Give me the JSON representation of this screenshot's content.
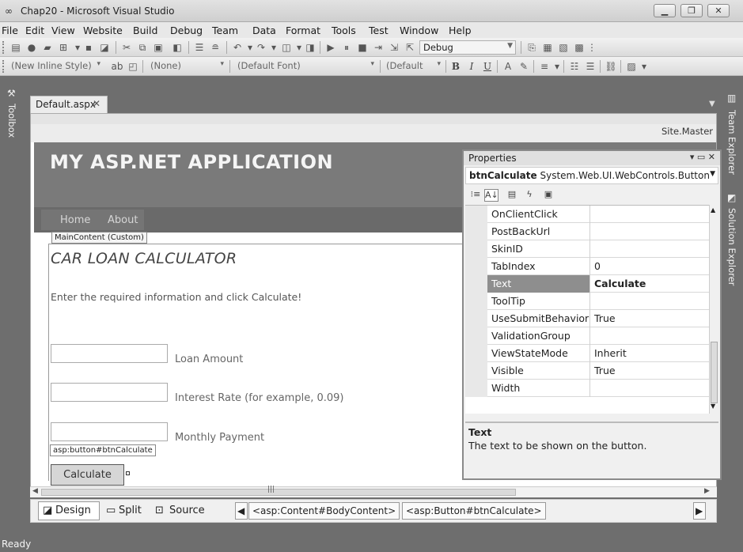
{
  "window": {
    "title": "Chap20 - Microsoft Visual Studio",
    "app_icon": "infinity-icon",
    "minimize_icon": "—",
    "restore_icon": "❐",
    "close_icon": "✕"
  },
  "menu": [
    "File",
    "Edit",
    "View",
    "Website",
    "Build",
    "Debug",
    "Team",
    "Data",
    "Format",
    "Tools",
    "Test",
    "Window",
    "Help"
  ],
  "toolbar1": {
    "config": "Debug"
  },
  "toolbar2": {
    "style_combo": "(New Inline Style)",
    "block_combo": "(None)",
    "font_combo": "(Default Font)",
    "size_combo": "(Default",
    "bold": "B",
    "italic": "I",
    "underline": "U"
  },
  "side_tabs": {
    "toolbox": "Toolbox",
    "team_explorer": "Team Explorer",
    "solution_explorer": "Solution Explorer"
  },
  "document": {
    "tab": "Default.aspx",
    "tab_close": "✕",
    "master": "Site.Master"
  },
  "page": {
    "app_title": "MY ASP.NET APPLICATION",
    "nav": [
      "Home",
      "About"
    ],
    "content_label": "MainContent (Custom)",
    "heading": "CAR LOAN CALCULATOR",
    "instructions": "Enter the required information and click Calculate!",
    "fields": [
      {
        "label": "Loan Amount",
        "value": ""
      },
      {
        "label": "Interest Rate (for example, 0.09)",
        "value": ""
      },
      {
        "label": "Monthly Payment",
        "value": ""
      }
    ],
    "button_tag": "asp:button#btnCalculate",
    "button_text": "Calculate"
  },
  "viewbar": {
    "design": "Design",
    "split": "Split",
    "source": "Source",
    "crumbs": [
      "<asp:Content#BodyContent>",
      "<asp:Button#btnCalculate>"
    ]
  },
  "properties": {
    "title": "Properties",
    "object_name": "btnCalculate",
    "object_type": "System.Web.UI.WebControls.Button",
    "rows": [
      {
        "name": "OnClientClick",
        "value": ""
      },
      {
        "name": "PostBackUrl",
        "value": ""
      },
      {
        "name": "SkinID",
        "value": ""
      },
      {
        "name": "TabIndex",
        "value": "0"
      },
      {
        "name": "Text",
        "value": "Calculate",
        "selected": true
      },
      {
        "name": "ToolTip",
        "value": ""
      },
      {
        "name": "UseSubmitBehavior",
        "value": "True"
      },
      {
        "name": "ValidationGroup",
        "value": ""
      },
      {
        "name": "ViewStateMode",
        "value": "Inherit"
      },
      {
        "name": "Visible",
        "value": "True"
      },
      {
        "name": "Width",
        "value": ""
      }
    ],
    "desc_title": "Text",
    "desc_body": "The text to be shown on the button."
  },
  "status": "Ready"
}
